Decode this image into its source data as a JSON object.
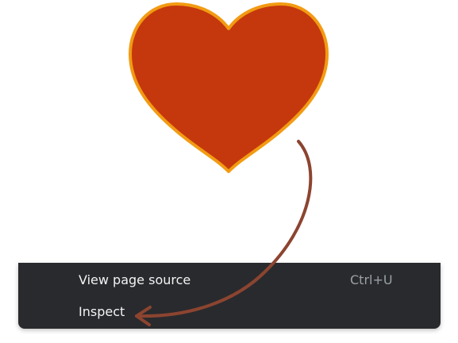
{
  "heart": {
    "icon": "heart-icon",
    "fill_color": "#c5380d",
    "outline_color": "#f29b12"
  },
  "context_menu": {
    "background_color": "#292a2d",
    "items": [
      {
        "label": "View page source",
        "shortcut": "Ctrl+U"
      },
      {
        "label": "Inspect",
        "shortcut": ""
      }
    ]
  },
  "pointer_arrow": {
    "icon": "curved-arrow-icon",
    "color": "#8c4430"
  }
}
